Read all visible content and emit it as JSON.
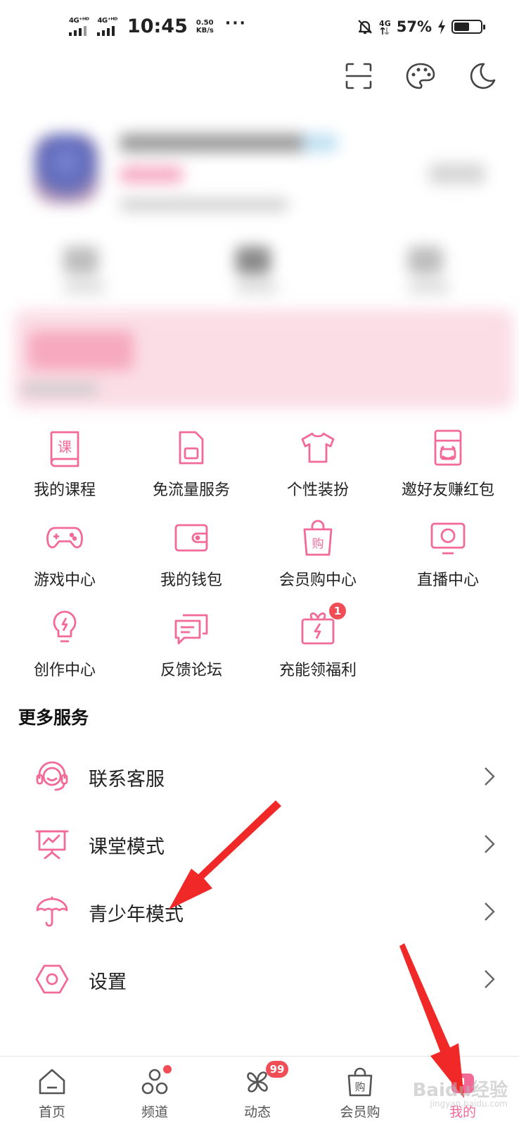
{
  "status_bar": {
    "sim1": "4G⁺ᴴᴰ",
    "sim2": "4G⁺ᴴᴰ",
    "time": "10:45",
    "speed_value": "0.50",
    "speed_unit": "KB/s",
    "more": "···",
    "net": "4G",
    "battery_percent": "57%",
    "battery_level": 0.57
  },
  "header_icons": [
    "scan-icon",
    "theme-palette-icon",
    "night-mode-icon"
  ],
  "services": {
    "rows": [
      [
        {
          "label": "我的课程",
          "icon": "course-book-icon",
          "glyph": "课"
        },
        {
          "label": "免流量服务",
          "icon": "sim-card-icon"
        },
        {
          "label": "个性装扮",
          "icon": "tshirt-icon"
        },
        {
          "label": "邀好友赚红包",
          "icon": "red-envelope-icon"
        }
      ],
      [
        {
          "label": "游戏中心",
          "icon": "gamepad-icon"
        },
        {
          "label": "我的钱包",
          "icon": "wallet-icon"
        },
        {
          "label": "会员购中心",
          "icon": "shopping-bag-icon",
          "glyph": "购"
        },
        {
          "label": "直播中心",
          "icon": "live-tv-icon"
        }
      ],
      [
        {
          "label": "创作中心",
          "icon": "lightbulb-icon"
        },
        {
          "label": "反馈论坛",
          "icon": "chat-bubbles-icon"
        },
        {
          "label": "充能领福利",
          "icon": "gift-box-icon",
          "badge": "1"
        }
      ]
    ]
  },
  "more_services": {
    "title": "更多服务",
    "items": [
      {
        "label": "联系客服",
        "icon": "headset-icon"
      },
      {
        "label": "课堂模式",
        "icon": "classroom-board-icon"
      },
      {
        "label": "青少年模式",
        "icon": "umbrella-icon"
      },
      {
        "label": "设置",
        "icon": "settings-hexagon-icon"
      }
    ]
  },
  "tabbar": {
    "tabs": [
      {
        "label": "首页",
        "icon": "home-icon"
      },
      {
        "label": "频道",
        "icon": "channels-icon",
        "dot": true
      },
      {
        "label": "动态",
        "icon": "pinwheel-icon",
        "badge": "99"
      },
      {
        "label": "会员购",
        "icon": "shopping-bag-icon",
        "glyph": "购"
      },
      {
        "label": "我的",
        "icon": "my-profile-icon",
        "active": true
      }
    ]
  },
  "watermark": {
    "main": "Baidu经验",
    "sub": "jingyan.baidu.com"
  },
  "colors": {
    "accent": "#f26b97",
    "badge": "#f04d57",
    "text": "#222222"
  }
}
